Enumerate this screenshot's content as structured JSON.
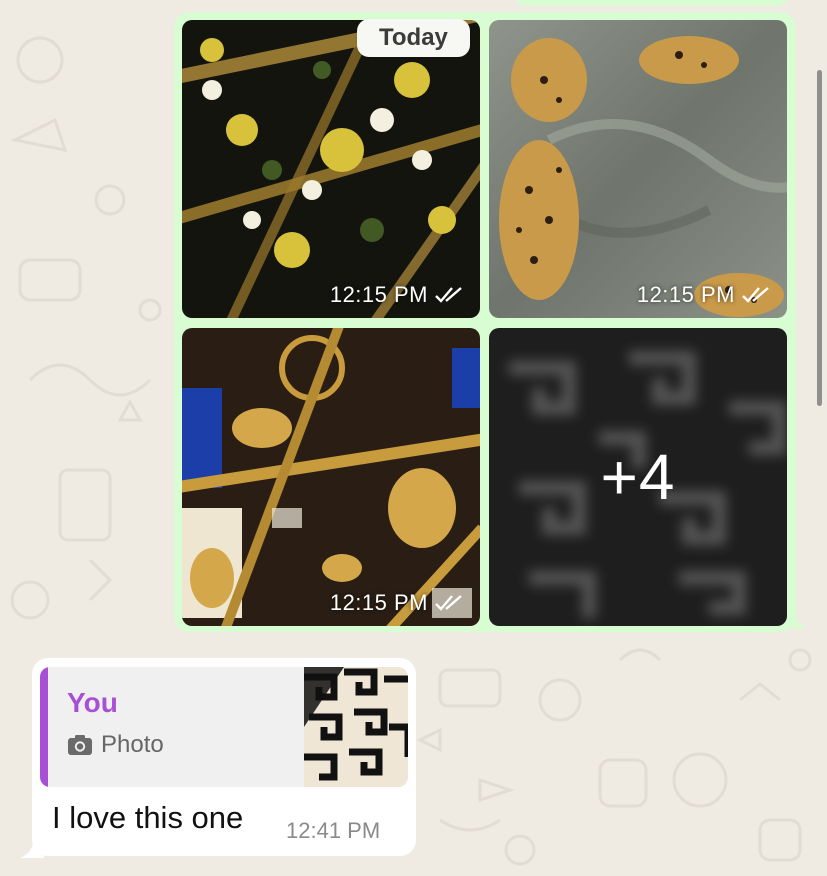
{
  "colors": {
    "outgoing_bubble": "#d9fdd3",
    "incoming_bubble": "#ffffff",
    "wallpaper": "#efeae2",
    "quote_accent": "#a94fd6"
  },
  "date_separator": "Today",
  "album": {
    "photos": [
      {
        "description_icon": "floral-chain-scarf-photo",
        "time": "12:15 PM",
        "status_icon": "double-check-icon"
      },
      {
        "description_icon": "leopard-scarf-photo",
        "time": "12:15 PM",
        "status_icon": "double-check-icon"
      },
      {
        "description_icon": "baroque-chain-scarf-photo",
        "time": "12:15 PM",
        "status_icon": "double-check-icon"
      }
    ],
    "more_count": "+4"
  },
  "reply_message": {
    "quote_author": "You",
    "quote_type_icon": "camera-icon",
    "quote_type": "Photo",
    "text": "I love this one",
    "time": "12:41 PM"
  }
}
